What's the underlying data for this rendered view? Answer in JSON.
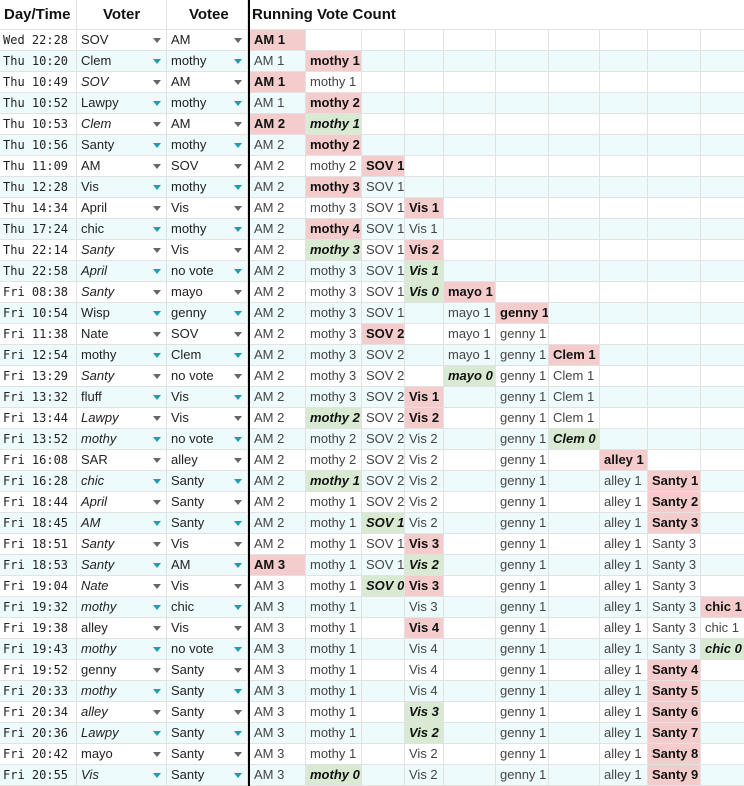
{
  "headers": [
    "Day/Time",
    "Voter",
    "Votee",
    "Running Vote Count"
  ],
  "colors": {
    "stripe": "#eefbfc",
    "arrow_teal": "#1a9fb0",
    "arrow_gray": "#666666",
    "red": "#f4cccc",
    "green": "#d9ead3"
  },
  "icons": {
    "dropdown": "triangle-down"
  },
  "rows": [
    {
      "time": "Wed 22:28",
      "voter": "SOV",
      "votee": "AM",
      "voter_i": false,
      "counts": [
        "[AM 1]"
      ]
    },
    {
      "time": "Thu 10:20",
      "voter": "Clem",
      "votee": "mothy",
      "voter_i": false,
      "counts": [
        "AM 1",
        "[mothy 1]"
      ]
    },
    {
      "time": "Thu 10:49",
      "voter": "SOV",
      "votee": "AM",
      "voter_i": true,
      "counts": [
        "[AM 1]",
        "mothy 1"
      ]
    },
    {
      "time": "Thu 10:52",
      "voter": "Lawpy",
      "votee": "mothy",
      "voter_i": false,
      "counts": [
        "AM 1",
        "[mothy 2]"
      ]
    },
    {
      "time": "Thu 10:53",
      "voter": "Clem",
      "votee": "AM",
      "voter_i": true,
      "counts": [
        "[AM 2]",
        "{mothy 1}"
      ]
    },
    {
      "time": "Thu 10:56",
      "voter": "Santy",
      "votee": "mothy",
      "voter_i": false,
      "counts": [
        "AM 2",
        "[mothy 2]"
      ]
    },
    {
      "time": "Thu 11:09",
      "voter": "AM",
      "votee": "SOV",
      "voter_i": false,
      "counts": [
        "AM 2",
        "mothy 2",
        "[SOV 1]"
      ]
    },
    {
      "time": "Thu 12:28",
      "voter": "Vis",
      "votee": "mothy",
      "voter_i": false,
      "counts": [
        "AM 2",
        "[mothy 3]",
        "SOV 1"
      ]
    },
    {
      "time": "Thu 14:34",
      "voter": "April",
      "votee": "Vis",
      "voter_i": false,
      "counts": [
        "AM 2",
        "mothy 3",
        "SOV 1",
        "[Vis 1]"
      ]
    },
    {
      "time": "Thu 17:24",
      "voter": "chic",
      "votee": "mothy",
      "voter_i": false,
      "counts": [
        "AM 2",
        "[mothy 4]",
        "SOV 1",
        "Vis 1"
      ]
    },
    {
      "time": "Thu 22:14",
      "voter": "Santy",
      "votee": "Vis",
      "voter_i": true,
      "counts": [
        "AM 2",
        "{mothy 3}",
        "SOV 1",
        "[Vis 2]"
      ]
    },
    {
      "time": "Thu 22:58",
      "voter": "April",
      "votee": "no vote",
      "voter_i": true,
      "counts": [
        "AM 2",
        "mothy 3",
        "SOV 1",
        "{Vis 1}"
      ]
    },
    {
      "time": "Fri 08:38",
      "voter": "Santy",
      "votee": "mayo",
      "voter_i": true,
      "counts": [
        "AM 2",
        "mothy 3",
        "SOV 1",
        "{Vis 0}",
        "[mayo 1]"
      ]
    },
    {
      "time": "Fri 10:54",
      "voter": "Wisp",
      "votee": "genny",
      "voter_i": false,
      "counts": [
        "AM 2",
        "mothy 3",
        "SOV 1",
        "",
        "mayo 1",
        "[genny 1]"
      ]
    },
    {
      "time": "Fri 11:38",
      "voter": "Nate",
      "votee": "SOV",
      "voter_i": false,
      "counts": [
        "AM 2",
        "mothy 3",
        "[SOV 2]",
        "",
        "mayo 1",
        "genny 1"
      ]
    },
    {
      "time": "Fri 12:54",
      "voter": "mothy",
      "votee": "Clem",
      "voter_i": false,
      "counts": [
        "AM 2",
        "mothy 3",
        "SOV 2",
        "",
        "mayo 1",
        "genny 1",
        "[Clem 1]"
      ]
    },
    {
      "time": "Fri 13:29",
      "voter": "Santy",
      "votee": "no vote",
      "voter_i": true,
      "counts": [
        "AM 2",
        "mothy 3",
        "SOV 2",
        "",
        "{mayo 0}",
        "genny 1",
        "Clem 1"
      ]
    },
    {
      "time": "Fri 13:32",
      "voter": "fluff",
      "votee": "Vis",
      "voter_i": false,
      "counts": [
        "AM 2",
        "mothy 3",
        "SOV 2",
        "[Vis 1]",
        "",
        "genny 1",
        "Clem 1"
      ]
    },
    {
      "time": "Fri 13:44",
      "voter": "Lawpy",
      "votee": "Vis",
      "voter_i": true,
      "counts": [
        "AM 2",
        "{mothy 2}",
        "SOV 2",
        "[Vis 2]",
        "",
        "genny 1",
        "Clem 1"
      ]
    },
    {
      "time": "Fri 13:52",
      "voter": "mothy",
      "votee": "no vote",
      "voter_i": true,
      "counts": [
        "AM 2",
        "mothy 2",
        "SOV 2",
        "Vis 2",
        "",
        "genny 1",
        "{Clem 0}"
      ]
    },
    {
      "time": "Fri 16:08",
      "voter": "SAR",
      "votee": "alley",
      "voter_i": false,
      "counts": [
        "AM 2",
        "mothy 2",
        "SOV 2",
        "Vis 2",
        "",
        "genny 1",
        "",
        "[alley 1]"
      ]
    },
    {
      "time": "Fri 16:28",
      "voter": "chic",
      "votee": "Santy",
      "voter_i": true,
      "counts": [
        "AM 2",
        "{mothy 1}",
        "SOV 2",
        "Vis 2",
        "",
        "genny 1",
        "",
        "alley 1",
        "[Santy 1]"
      ]
    },
    {
      "time": "Fri 18:44",
      "voter": "April",
      "votee": "Santy",
      "voter_i": true,
      "counts": [
        "AM 2",
        "mothy 1",
        "SOV 2",
        "Vis 2",
        "",
        "genny 1",
        "",
        "alley 1",
        "[Santy 2]"
      ]
    },
    {
      "time": "Fri 18:45",
      "voter": "AM",
      "votee": "Santy",
      "voter_i": true,
      "counts": [
        "AM 2",
        "mothy 1",
        "{SOV 1}",
        "Vis 2",
        "",
        "genny 1",
        "",
        "alley 1",
        "[Santy 3]"
      ]
    },
    {
      "time": "Fri 18:51",
      "voter": "Santy",
      "votee": "Vis",
      "voter_i": true,
      "counts": [
        "AM 2",
        "mothy 1",
        "SOV 1",
        "[Vis 3]",
        "",
        "genny 1",
        "",
        "alley 1",
        "Santy 3"
      ]
    },
    {
      "time": "Fri 18:53",
      "voter": "Santy",
      "votee": "AM",
      "voter_i": true,
      "counts": [
        "[AM 3]",
        "mothy 1",
        "SOV 1",
        "{Vis 2}",
        "",
        "genny 1",
        "",
        "alley 1",
        "Santy 3"
      ]
    },
    {
      "time": "Fri 19:04",
      "voter": "Nate",
      "votee": "Vis",
      "voter_i": true,
      "counts": [
        "AM 3",
        "mothy 1",
        "{SOV 0}",
        "[Vis 3]",
        "",
        "genny 1",
        "",
        "alley 1",
        "Santy 3"
      ]
    },
    {
      "time": "Fri 19:32",
      "voter": "mothy",
      "votee": "chic",
      "voter_i": true,
      "counts": [
        "AM 3",
        "mothy 1",
        "",
        "Vis 3",
        "",
        "genny 1",
        "",
        "alley 1",
        "Santy 3",
        "[chic 1]"
      ]
    },
    {
      "time": "Fri 19:38",
      "voter": "alley",
      "votee": "Vis",
      "voter_i": false,
      "counts": [
        "AM 3",
        "mothy 1",
        "",
        "[Vis 4]",
        "",
        "genny 1",
        "",
        "alley 1",
        "Santy 3",
        "chic 1"
      ]
    },
    {
      "time": "Fri 19:43",
      "voter": "mothy",
      "votee": "no vote",
      "voter_i": true,
      "counts": [
        "AM 3",
        "mothy 1",
        "",
        "Vis 4",
        "",
        "genny 1",
        "",
        "alley 1",
        "Santy 3",
        "{chic 0}"
      ]
    },
    {
      "time": "Fri 19:52",
      "voter": "genny",
      "votee": "Santy",
      "voter_i": false,
      "counts": [
        "AM 3",
        "mothy 1",
        "",
        "Vis 4",
        "",
        "genny 1",
        "",
        "alley 1",
        "[Santy 4]"
      ]
    },
    {
      "time": "Fri 20:33",
      "voter": "mothy",
      "votee": "Santy",
      "voter_i": true,
      "counts": [
        "AM 3",
        "mothy 1",
        "",
        "Vis 4",
        "",
        "genny 1",
        "",
        "alley 1",
        "[Santy 5]"
      ]
    },
    {
      "time": "Fri 20:34",
      "voter": "alley",
      "votee": "Santy",
      "voter_i": true,
      "counts": [
        "AM 3",
        "mothy 1",
        "",
        "{Vis 3}",
        "",
        "genny 1",
        "",
        "alley 1",
        "[Santy 6]"
      ]
    },
    {
      "time": "Fri 20:36",
      "voter": "Lawpy",
      "votee": "Santy",
      "voter_i": true,
      "counts": [
        "AM 3",
        "mothy 1",
        "",
        "{Vis 2}",
        "",
        "genny 1",
        "",
        "alley 1",
        "[Santy 7]"
      ]
    },
    {
      "time": "Fri 20:42",
      "voter": "mayo",
      "votee": "Santy",
      "voter_i": false,
      "counts": [
        "AM 3",
        "mothy 1",
        "",
        "Vis 2",
        "",
        "genny 1",
        "",
        "alley 1",
        "[Santy 8]"
      ]
    },
    {
      "time": "Fri 20:55",
      "voter": "Vis",
      "votee": "Santy",
      "voter_i": true,
      "counts": [
        "AM 3",
        "{mothy 0}",
        "",
        "Vis 2",
        "",
        "genny 1",
        "",
        "alley 1",
        "[Santy 9]"
      ]
    }
  ]
}
